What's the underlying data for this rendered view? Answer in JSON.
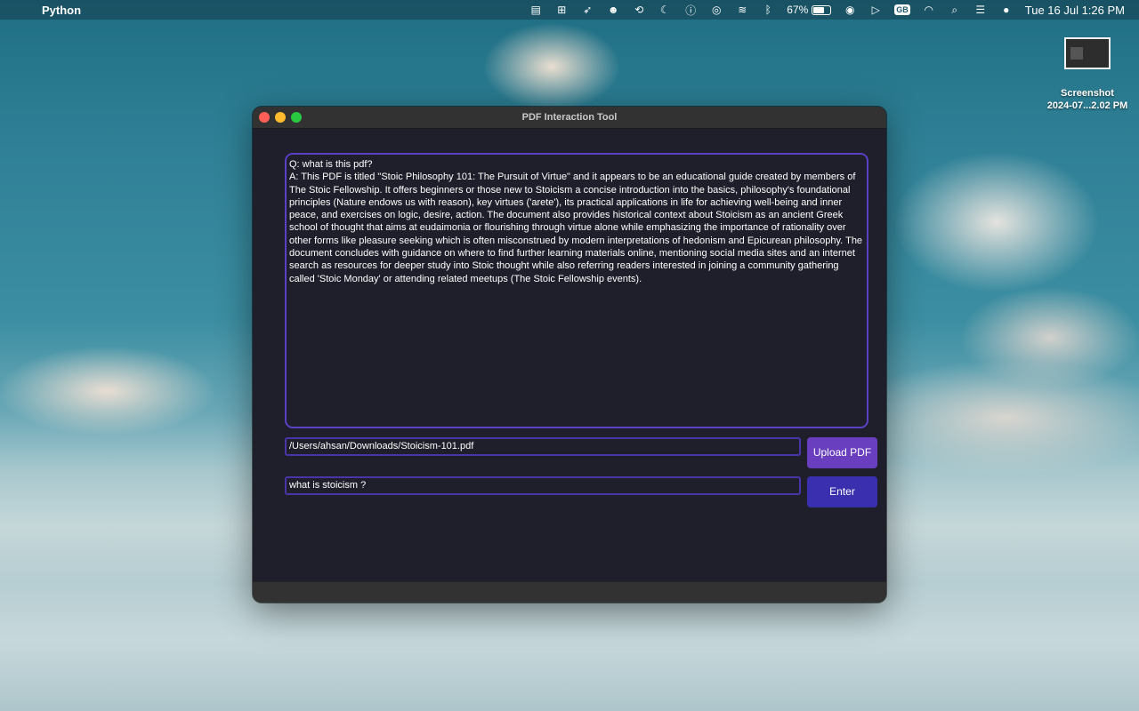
{
  "menubar": {
    "app_name": "Python",
    "battery_percent": "67%",
    "battery_level": 0.67,
    "keyboard_layout": "GB",
    "clock": "Tue 16 Jul  1:26 PM",
    "icons": [
      "apple-logo",
      "clipboard-icon",
      "grid-icon",
      "rocket-icon",
      "face-icon",
      "rotate-icon",
      "moon-icon",
      "accessibility-icon",
      "airdrop-icon",
      "wave-icon",
      "bluetooth-icon",
      "battery-icon",
      "user-icon",
      "play-icon",
      "wifi-icon",
      "search-icon",
      "control-center-icon",
      "siri-icon"
    ]
  },
  "desktop": {
    "screenshot_label_line1": "Screenshot",
    "screenshot_label_line2": "2024-07...2.02 PM"
  },
  "window": {
    "title": "PDF Interaction Tool",
    "output_text": "Q: what is this pdf?\nA: This PDF is titled \"Stoic Philosophy 101: The Pursuit of Virtue\" and it appears to be an educational guide created by members of The Stoic Fellowship. It offers beginners or those new to Stoicism a concise introduction into the basics, philosophy's foundational principles (Nature endows us with reason), key virtues ('arete'), its practical applications in life for achieving well-being and inner peace, and exercises on logic, desire, action. The document also provides historical context about Stoicism as an ancient Greek school of thought that aims at eudaimonia or flourishing through virtue alone while emphasizing the importance of rationality over other forms like pleasure seeking which is often misconstrued by modern interpretations of hedonism and Epicurean philosophy. The document concludes with guidance on where to find further learning materials online, mentioning social media sites and an internet search as resources for deeper study into Stoic thought while also referring readers interested in joining a community gathering called 'Stoic Monday' or attending related meetups (The Stoic Fellowship events).",
    "pdf_path": "/Users/ahsan/Downloads/Stoicism-101.pdf",
    "upload_label": "Upload PDF",
    "question_value": "what is stoicism ?",
    "enter_label": "Enter"
  },
  "colors": {
    "accent_border": "#5b3fc4",
    "upload_button": "#6a3fbf",
    "enter_button": "#3a2fae",
    "window_bg": "#1f1f2b"
  }
}
